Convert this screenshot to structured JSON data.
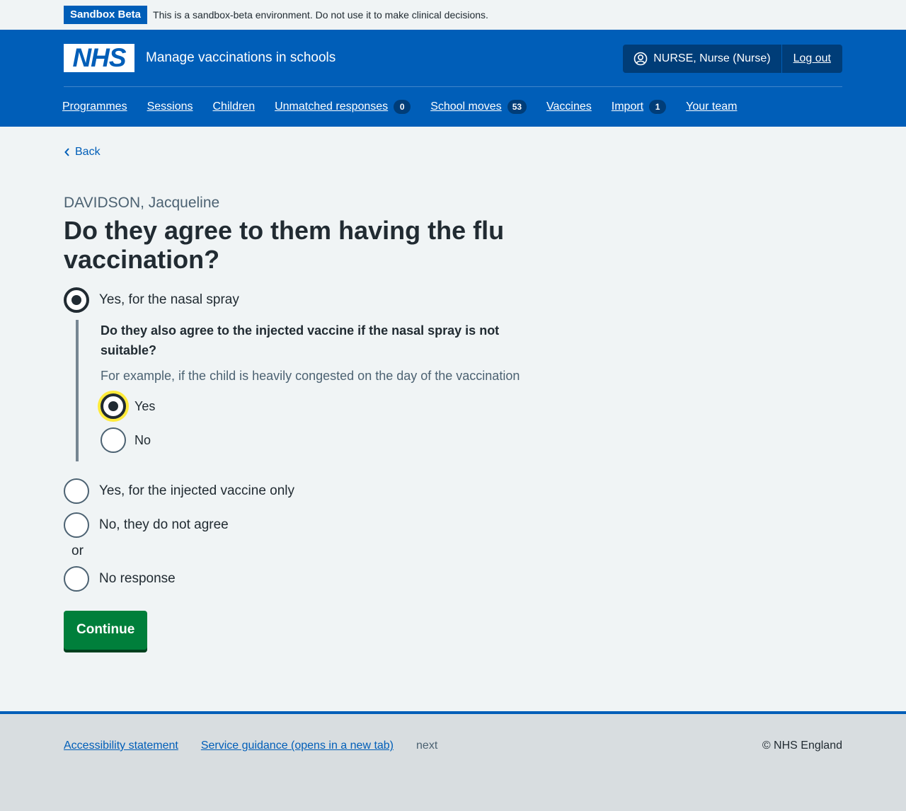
{
  "banner": {
    "tag": "Sandbox Beta",
    "text": "This is a sandbox-beta environment. Do not use it to make clinical decisions."
  },
  "header": {
    "logo_text": "NHS",
    "service_name": "Manage vaccinations in schools",
    "user": "NURSE, Nurse (Nurse)",
    "logout": "Log out"
  },
  "nav": [
    {
      "label": "Programmes"
    },
    {
      "label": "Sessions"
    },
    {
      "label": "Children"
    },
    {
      "label": "Unmatched responses",
      "count": "0"
    },
    {
      "label": "School moves",
      "count": "53"
    },
    {
      "label": "Vaccines"
    },
    {
      "label": "Import",
      "count": "1"
    },
    {
      "label": "Your team"
    }
  ],
  "main": {
    "back": "Back",
    "caption": "DAVIDSON, Jacqueline",
    "heading": "Do they agree to them having the flu vaccination?",
    "options": {
      "nasal": "Yes, for the nasal spray",
      "injected_only": "Yes, for the injected vaccine only",
      "no": "No, they do not agree",
      "or": "or",
      "no_response": "No response"
    },
    "conditional": {
      "question": "Do they also agree to the injected vaccine if the nasal spray is not suitable?",
      "hint": "For example, if the child is heavily congested on the day of the vaccination",
      "yes": "Yes",
      "no": "No"
    },
    "selected": {
      "consent": "Yes, for the nasal spray",
      "injected_alternative": "Yes"
    },
    "continue": "Continue"
  },
  "footer": {
    "accessibility": "Accessibility statement",
    "guidance": "Service guidance (opens in a new tab)",
    "next": "next",
    "copyright": "© NHS England"
  },
  "colors": {
    "nhs_blue": "#005eb8",
    "dark_blue": "#003d78",
    "green": "#007f3b",
    "background": "#f0f4f5",
    "text": "#212b32",
    "secondary_text": "#4c6272",
    "focus": "#ffeb3b"
  }
}
